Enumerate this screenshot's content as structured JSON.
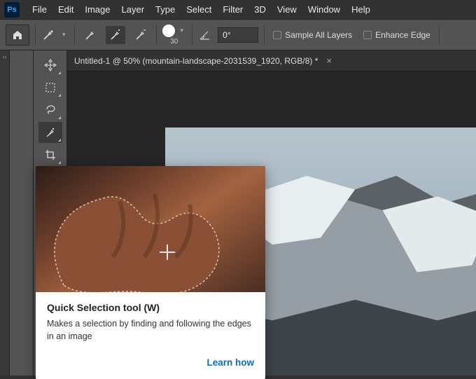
{
  "menu": {
    "items": [
      "File",
      "Edit",
      "Image",
      "Layer",
      "Type",
      "Select",
      "Filter",
      "3D",
      "View",
      "Window",
      "Help"
    ]
  },
  "logo": "Ps",
  "options": {
    "brush_size": "30",
    "angle_value": "0°",
    "sample_all_layers": "Sample All Layers",
    "enhance_edge": "Enhance Edge"
  },
  "tab": {
    "label": "Untitled-1 @ 50% (mountain-landscape-2031539_1920, RGB/8) *",
    "close": "×"
  },
  "tooltip": {
    "title": "Quick Selection tool (W)",
    "desc": "Makes a selection by finding and following the edges in an image",
    "learn": "Learn how"
  },
  "tools": {
    "move": "move-tool",
    "marquee": "rectangular-marquee-tool",
    "lasso": "lasso-tool",
    "quick": "quick-selection-tool",
    "crop": "crop-tool",
    "frame": "frame-tool",
    "eyedropper": "eyedropper-tool",
    "heal": "healing-brush-tool",
    "brush": "brush-tool",
    "stamp": "clone-stamp-tool",
    "history": "history-brush-tool",
    "eraser": "eraser-tool",
    "gradient": "gradient-tool"
  }
}
